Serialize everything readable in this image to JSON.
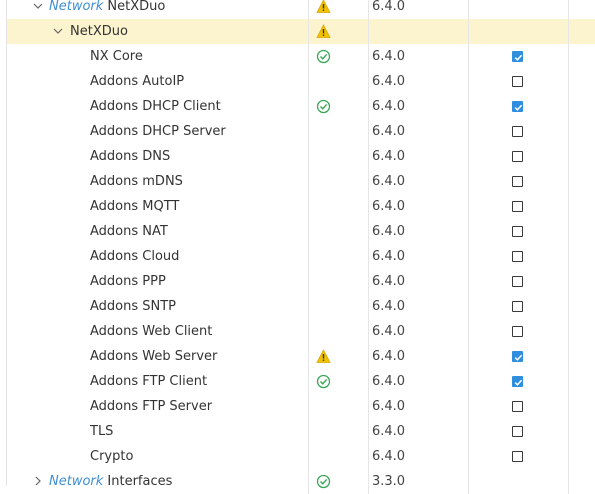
{
  "rows": [
    {
      "vendor": "Network",
      "name": "NetXDuo",
      "status": "warning",
      "version": "6.4.0",
      "checkbox": null,
      "chevron": "down"
    },
    {
      "vendor": "",
      "name": "NetXDuo",
      "status": "warning",
      "version": "",
      "checkbox": null,
      "chevron": "down",
      "selected": true
    },
    {
      "name": "NX Core",
      "status": "ok",
      "version": "6.4.0",
      "checkbox": true
    },
    {
      "name": "Addons AutoIP",
      "status": "",
      "version": "6.4.0",
      "checkbox": false
    },
    {
      "name": "Addons DHCP Client",
      "status": "ok",
      "version": "6.4.0",
      "checkbox": true
    },
    {
      "name": "Addons DHCP Server",
      "status": "",
      "version": "6.4.0",
      "checkbox": false
    },
    {
      "name": "Addons DNS",
      "status": "",
      "version": "6.4.0",
      "checkbox": false
    },
    {
      "name": "Addons mDNS",
      "status": "",
      "version": "6.4.0",
      "checkbox": false
    },
    {
      "name": "Addons MQTT",
      "status": "",
      "version": "6.4.0",
      "checkbox": false
    },
    {
      "name": "Addons NAT",
      "status": "",
      "version": "6.4.0",
      "checkbox": false
    },
    {
      "name": "Addons Cloud",
      "status": "",
      "version": "6.4.0",
      "checkbox": false
    },
    {
      "name": "Addons PPP",
      "status": "",
      "version": "6.4.0",
      "checkbox": false
    },
    {
      "name": "Addons SNTP",
      "status": "",
      "version": "6.4.0",
      "checkbox": false
    },
    {
      "name": "Addons Web Client",
      "status": "",
      "version": "6.4.0",
      "checkbox": false
    },
    {
      "name": "Addons Web Server",
      "status": "warning",
      "version": "6.4.0",
      "checkbox": true
    },
    {
      "name": "Addons FTP Client",
      "status": "ok",
      "version": "6.4.0",
      "checkbox": true
    },
    {
      "name": "Addons FTP Server",
      "status": "",
      "version": "6.4.0",
      "checkbox": false
    },
    {
      "name": "TLS",
      "status": "",
      "version": "6.4.0",
      "checkbox": false
    },
    {
      "name": "Crypto",
      "status": "",
      "version": "6.4.0",
      "checkbox": false
    },
    {
      "vendor": "Network",
      "name": "Interfaces",
      "status": "ok",
      "version": "3.3.0",
      "checkbox": null,
      "chevron": "right"
    }
  ],
  "icons": {
    "warning": "warning-icon",
    "ok": "check-circle-icon",
    "expanded": "chevron-down-icon",
    "collapsed": "chevron-right-icon"
  },
  "colors": {
    "warning": "#f2c200",
    "ok": "#3aa655",
    "checkbox_checked": "#2f8fde",
    "vendor_text": "#3f8fd5",
    "selected_row": "#fbf4cf"
  }
}
